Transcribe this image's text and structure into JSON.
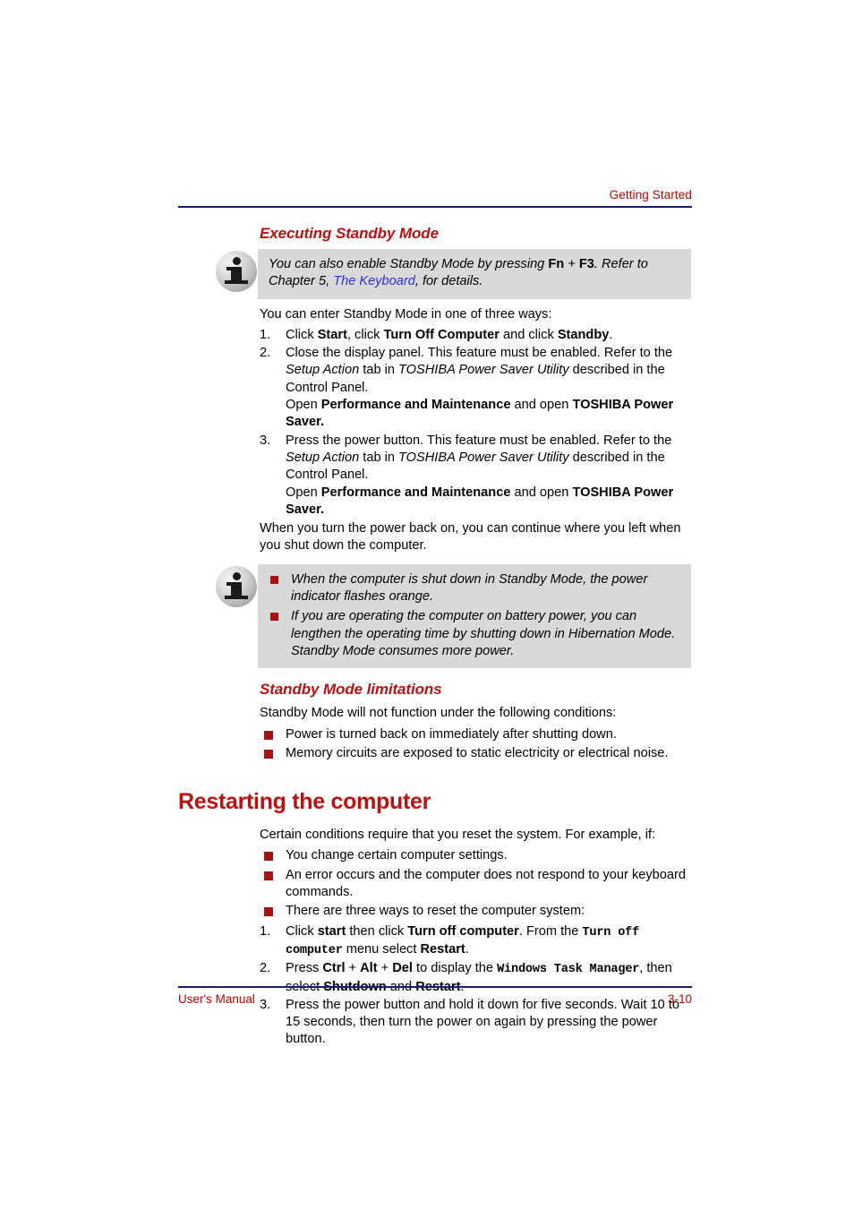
{
  "header": {
    "running_head": "Getting Started",
    "rule_color": "#19197a",
    "text_color": "#c00000"
  },
  "section_standby": {
    "heading": "Executing Standby Mode",
    "note1": {
      "icon": "info-icon",
      "line1_a": "You can also enable Standby Mode by pressing ",
      "line1_fn": "Fn",
      "line1_plus": " + ",
      "line1_f3": "F3",
      "line1_b": ". Refer to Chapter 5, ",
      "link": "The Keyboard",
      "line1_c": ", for details."
    },
    "intro": "You can enter Standby Mode in one of three ways:",
    "steps": [
      {
        "num": "1.",
        "parts": [
          {
            "t": "Click ",
            "s": "n"
          },
          {
            "t": "Start",
            "s": "b"
          },
          {
            "t": ", click ",
            "s": "n"
          },
          {
            "t": "Turn Off Computer",
            "s": "b"
          },
          {
            "t": " and click ",
            "s": "n"
          },
          {
            "t": "Standby",
            "s": "b"
          },
          {
            "t": ".",
            "s": "n"
          }
        ]
      },
      {
        "num": "2.",
        "parts": [
          {
            "t": "Close the display panel. This feature must be enabled. Refer to the ",
            "s": "n"
          },
          {
            "t": "Setup Action",
            "s": "i"
          },
          {
            "t": " tab in ",
            "s": "n"
          },
          {
            "t": "TOSHIBA Power Saver Utility",
            "s": "i"
          },
          {
            "t": " described in the Control Panel.",
            "s": "n"
          },
          {
            "t": "\n",
            "s": "br"
          },
          {
            "t": "Open ",
            "s": "n"
          },
          {
            "t": "Performance and Maintenance",
            "s": "b"
          },
          {
            "t": " and open ",
            "s": "n"
          },
          {
            "t": "TOSHIBA Power Saver.",
            "s": "b"
          }
        ]
      },
      {
        "num": "3.",
        "parts": [
          {
            "t": "Press the power button. This feature must be enabled. Refer to the ",
            "s": "n"
          },
          {
            "t": "Setup Action",
            "s": "i"
          },
          {
            "t": " tab in ",
            "s": "n"
          },
          {
            "t": "TOSHIBA Power Saver Utility",
            "s": "i"
          },
          {
            "t": " described in the Control Panel.",
            "s": "n"
          },
          {
            "t": "\n",
            "s": "br"
          },
          {
            "t": "Open ",
            "s": "n"
          },
          {
            "t": "Performance and Maintenance",
            "s": "b"
          },
          {
            "t": " and open ",
            "s": "n"
          },
          {
            "t": "TOSHIBA Power Saver.",
            "s": "b"
          }
        ]
      }
    ],
    "closing": "When you turn the power back on, you can continue where you left when you shut down the computer.",
    "note2": {
      "icon": "info-icon",
      "bullets": [
        "When the computer is shut down in Standby Mode, the power indicator flashes orange.",
        "If you are operating the computer on battery power, you can lengthen the operating time by shutting down in Hibernation Mode. Standby Mode consumes more power."
      ]
    }
  },
  "section_limitations": {
    "heading": "Standby Mode limitations",
    "intro": "Standby Mode will not function under the following conditions:",
    "bullets": [
      "Power is turned back on immediately after shutting down.",
      "Memory circuits are exposed to static electricity or electrical noise."
    ]
  },
  "section_restarting": {
    "heading": "Restarting the computer",
    "intro": "Certain conditions require that you reset the system. For example, if:",
    "bullets": [
      "You change certain computer settings.",
      "An error occurs and the computer does not respond to your keyboard commands.",
      "There are three ways to reset the computer system:"
    ],
    "steps": [
      {
        "num": "1.",
        "parts": [
          {
            "t": "Click ",
            "s": "n"
          },
          {
            "t": "start",
            "s": "b"
          },
          {
            "t": " then click ",
            "s": "n"
          },
          {
            "t": "Turn off computer",
            "s": "b"
          },
          {
            "t": ". From the ",
            "s": "n"
          },
          {
            "t": "Turn off computer",
            "s": "m"
          },
          {
            "t": " menu select ",
            "s": "n"
          },
          {
            "t": "Restart",
            "s": "b"
          },
          {
            "t": ".",
            "s": "n"
          }
        ]
      },
      {
        "num": "2.",
        "parts": [
          {
            "t": "Press ",
            "s": "n"
          },
          {
            "t": "Ctrl",
            "s": "b"
          },
          {
            "t": " + ",
            "s": "n"
          },
          {
            "t": "Alt",
            "s": "b"
          },
          {
            "t": " + ",
            "s": "n"
          },
          {
            "t": "Del",
            "s": "b"
          },
          {
            "t": " to display the ",
            "s": "n"
          },
          {
            "t": "Windows Task Manager",
            "s": "m"
          },
          {
            "t": ", then select ",
            "s": "n"
          },
          {
            "t": "Shutdown",
            "s": "b"
          },
          {
            "t": " and ",
            "s": "n"
          },
          {
            "t": "Restart",
            "s": "b"
          },
          {
            "t": ".",
            "s": "n"
          }
        ]
      },
      {
        "num": "3.",
        "parts": [
          {
            "t": "Press the power button and hold it down for five seconds. Wait 10 to 15 seconds, then turn the power on again by pressing the power button.",
            "s": "n"
          }
        ]
      }
    ]
  },
  "footer": {
    "left": "User's Manual",
    "right": "3-10",
    "rule_color": "#19197a",
    "text_color": "#c00000"
  },
  "colors": {
    "heading_red": "#bb1111",
    "bullet_red": "#ab1010",
    "link_blue": "#2a33d8",
    "note_bg": "#d9d9d9",
    "rule_navy": "#19197a"
  }
}
